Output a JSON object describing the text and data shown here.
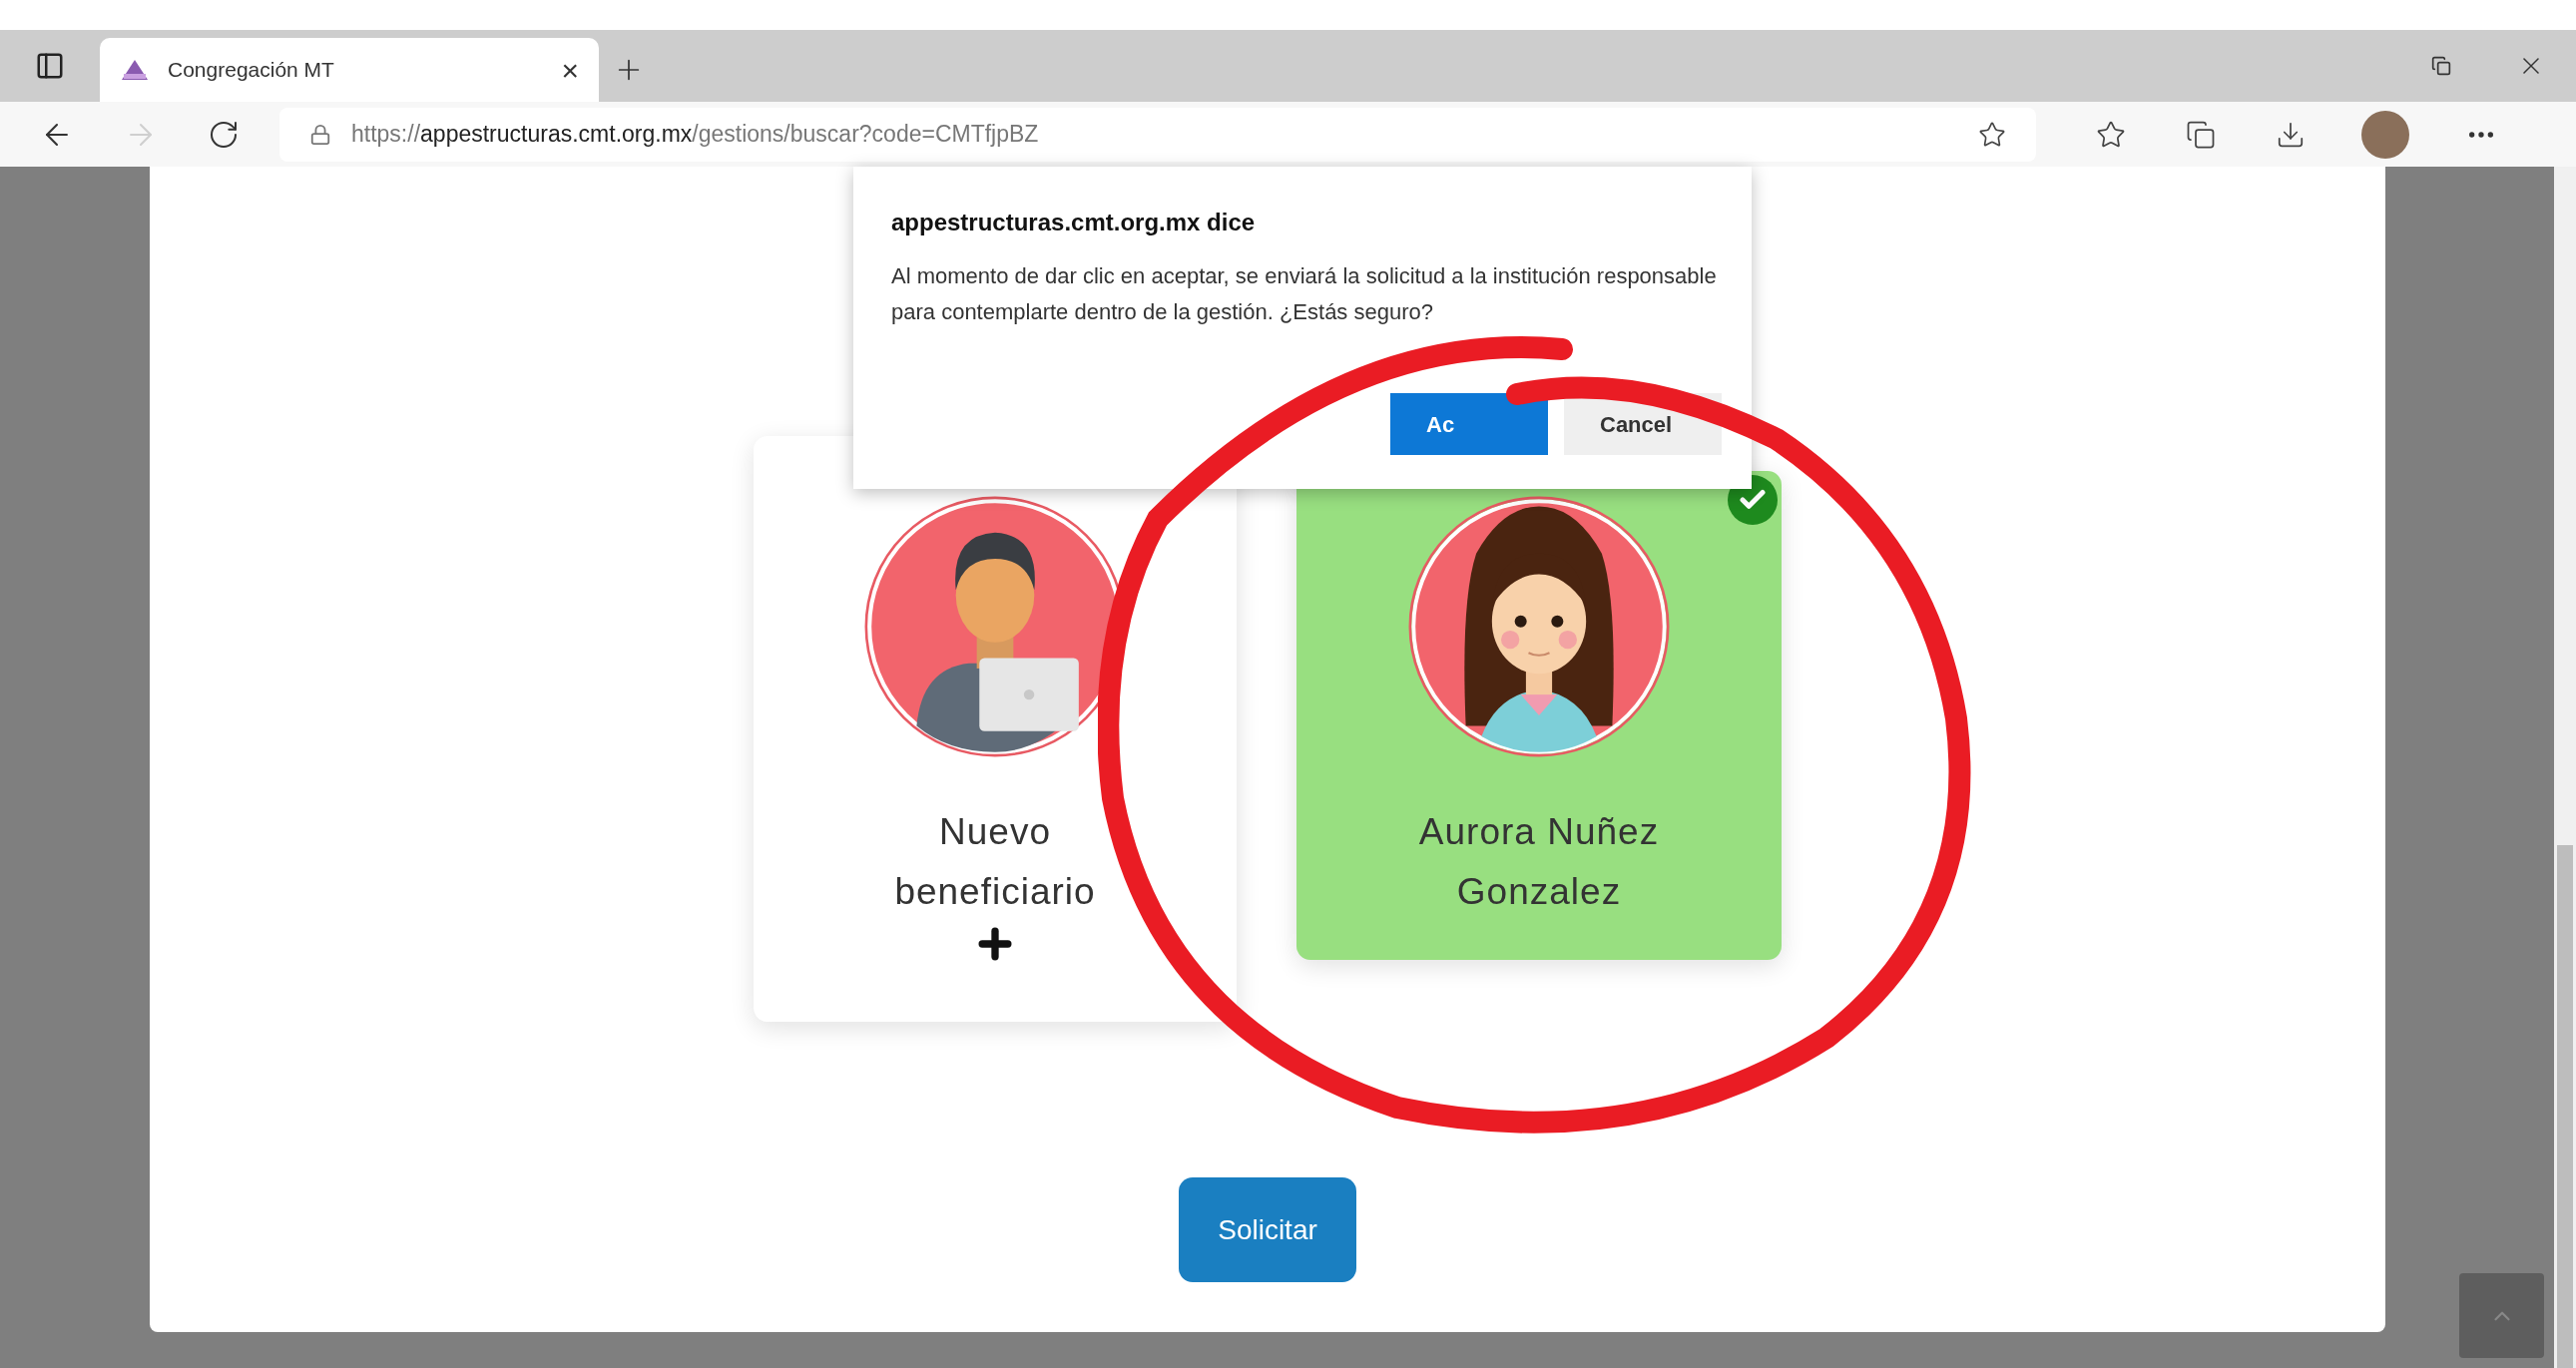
{
  "browser": {
    "tab": {
      "title": "Congregación MT",
      "close": "×"
    },
    "address": {
      "scheme": "https://",
      "host": "appestructuras.cmt.org.mx",
      "path": "/gestions/buscar?code=CMTfjpBZ"
    }
  },
  "dialog": {
    "title": "appestructuras.cmt.org.mx dice",
    "message": "Al momento de dar clic en aceptar, se enviará la solicitud a la institución responsable para contemplarte dentro de la gestión. ¿Estás seguro?",
    "buttons": [
      {
        "label": "Ac",
        "kind": "primary"
      },
      {
        "label": "Cancel",
        "kind": "secondary"
      }
    ]
  },
  "beneficiaries": [
    {
      "name": "Nuevo beneficiario",
      "kind": "add",
      "selected": false
    },
    {
      "name": "Aurora Nuñez Gonzalez",
      "kind": "person",
      "selected": true
    }
  ],
  "submit": {
    "label": "Solicitar"
  }
}
